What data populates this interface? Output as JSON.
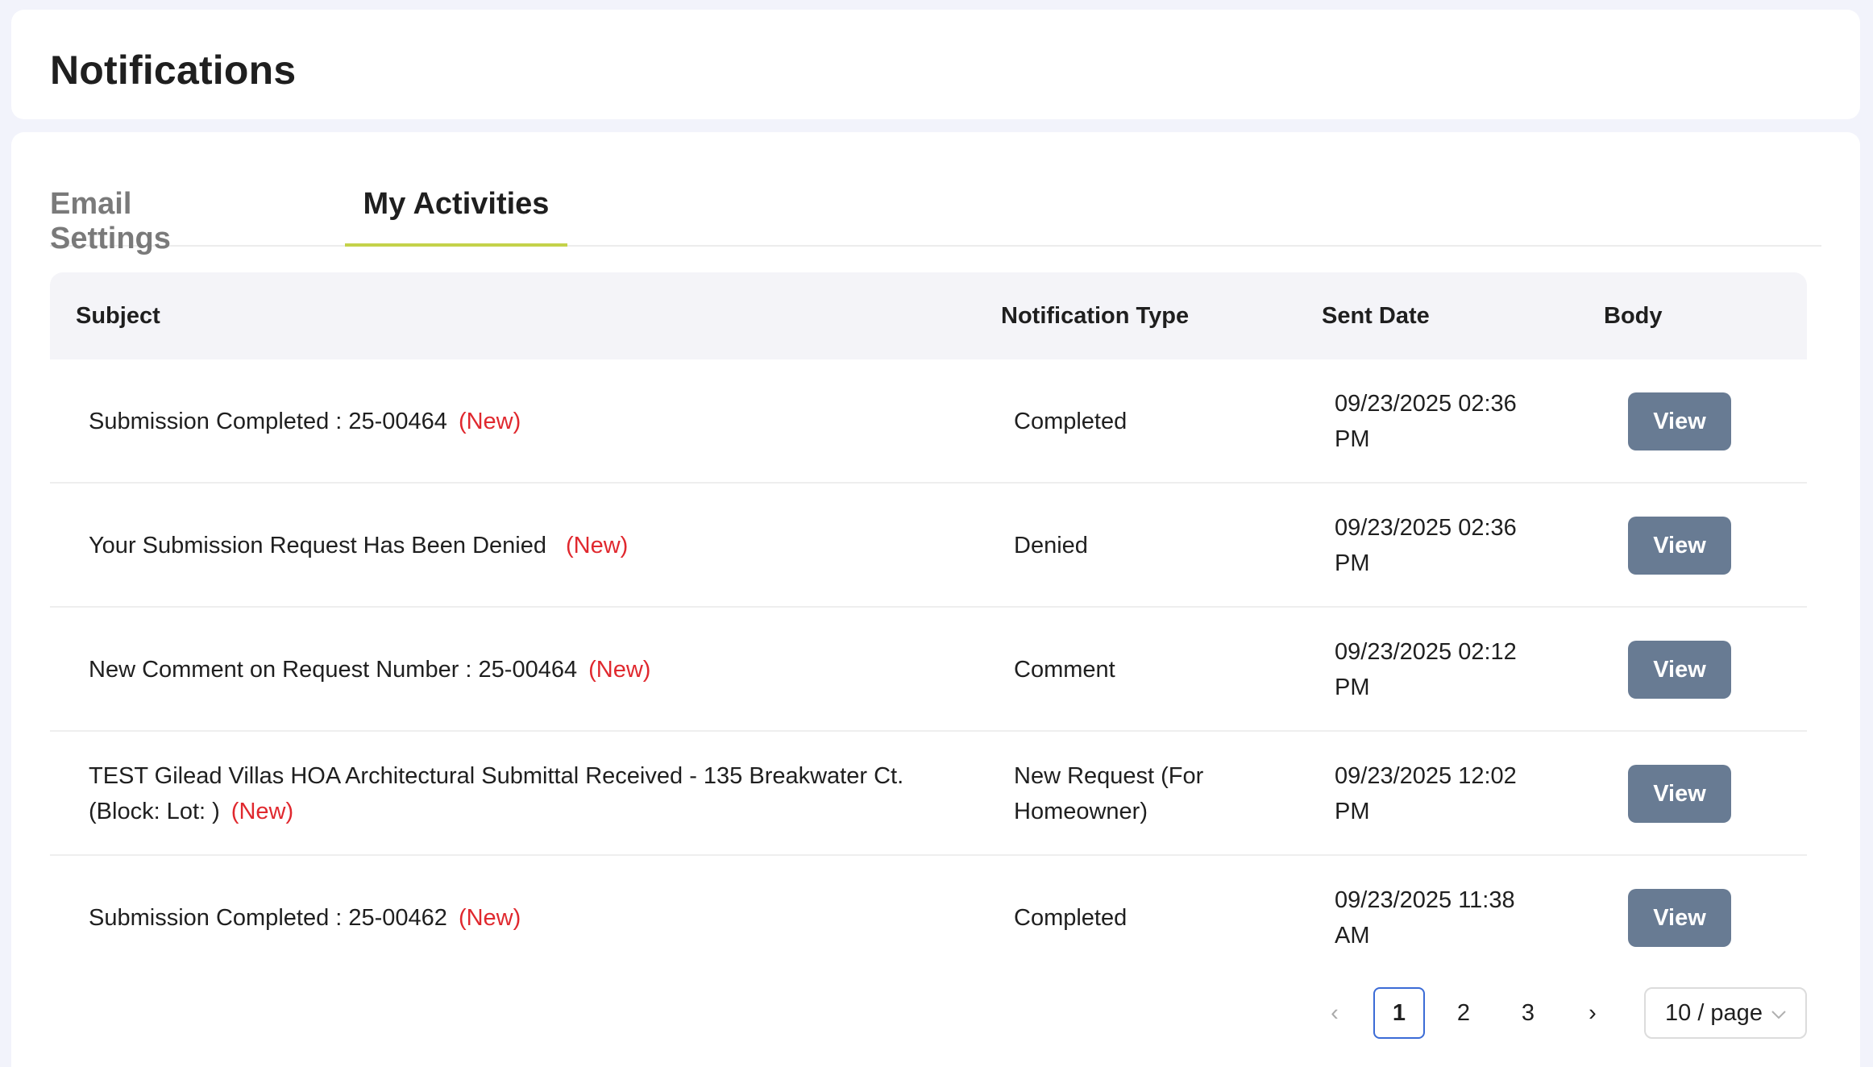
{
  "page": {
    "title": "Notifications"
  },
  "tabs": [
    {
      "label": "Email Settings",
      "active": false
    },
    {
      "label": "My Activities",
      "active": true
    }
  ],
  "table": {
    "headers": {
      "subject": "Subject",
      "type": "Notification Type",
      "date": "Sent Date",
      "body": "Body"
    },
    "new_tag": "(New)",
    "view_label": "View",
    "rows": [
      {
        "subject_line1": "Submission Completed : 25-00464",
        "subject_line2": "",
        "type_line1": "Completed",
        "type_line2": "",
        "date_line1": "09/23/2025 02:36",
        "date_line2": "PM"
      },
      {
        "subject_line1": "Your Submission Request Has Been Denied",
        "subject_line2": "",
        "type_line1": "Denied",
        "type_line2": "",
        "date_line1": "09/23/2025 02:36",
        "date_line2": "PM"
      },
      {
        "subject_line1": "New Comment on Request Number : 25-00464",
        "subject_line2": "",
        "type_line1": "Comment",
        "type_line2": "",
        "date_line1": "09/23/2025 02:12",
        "date_line2": "PM"
      },
      {
        "subject_line1": "TEST Gilead Villas HOA Architectural Submittal Received - 135 Breakwater Ct.",
        "subject_line2": "(Block: Lot: )",
        "type_line1": "New Request (For",
        "type_line2": "Homeowner)",
        "date_line1": "09/23/2025 12:02",
        "date_line2": "PM"
      },
      {
        "subject_line1": "Submission Completed : 25-00462",
        "subject_line2": "",
        "type_line1": "Completed",
        "type_line2": "",
        "date_line1": "09/23/2025 11:38",
        "date_line2": "AM"
      }
    ]
  },
  "pagination": {
    "pages": [
      "1",
      "2",
      "3"
    ],
    "current": "1",
    "prev_icon": "‹",
    "next_icon": "›",
    "page_size": "10 / page",
    "dropdown_icon": "chevron-down-icon"
  },
  "colors": {
    "accent_underline": "#c4d24a",
    "new_tag": "#e0282e",
    "view_button": "#687b93",
    "current_page_border": "#3b6bd6"
  }
}
